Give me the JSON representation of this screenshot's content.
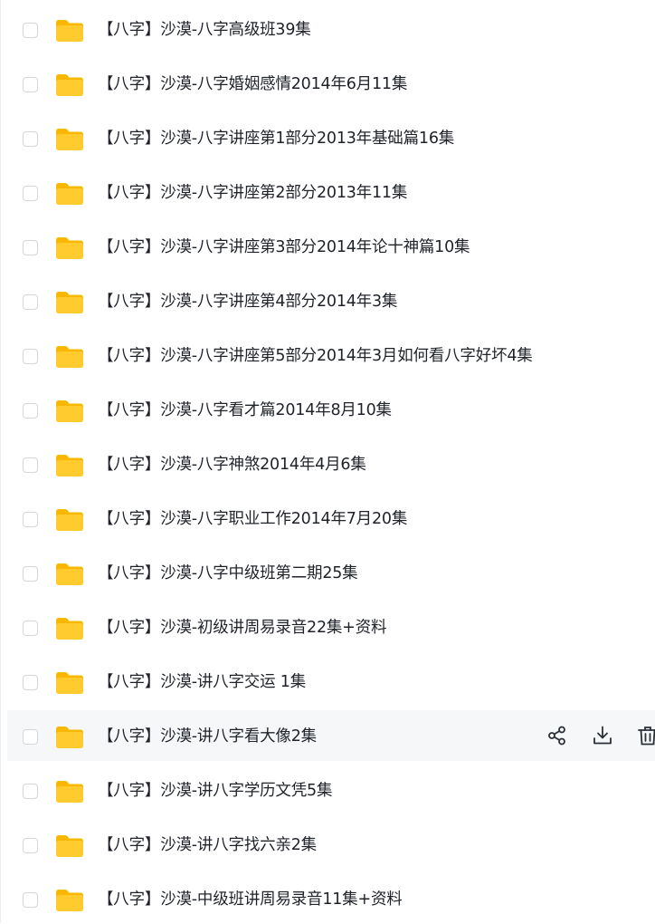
{
  "colors": {
    "folder": "#ffcb2f",
    "folder_tab": "#f9b800",
    "text": "#1f2329",
    "hover_row": "#f6f7f9",
    "checkbox_border": "#d3d6db",
    "action_icon": "#2b2f36"
  },
  "files": [
    {
      "name": "【八字】沙漠-八字高级班39集",
      "icon": "folder-icon"
    },
    {
      "name": "【八字】沙漠-八字婚姻感情2014年6月11集",
      "icon": "folder-icon"
    },
    {
      "name": "【八字】沙漠-八字讲座第1部分2013年基础篇16集",
      "icon": "folder-icon"
    },
    {
      "name": "【八字】沙漠-八字讲座第2部分2013年11集",
      "icon": "folder-icon"
    },
    {
      "name": "【八字】沙漠-八字讲座第3部分2014年论十神篇10集",
      "icon": "folder-icon"
    },
    {
      "name": "【八字】沙漠-八字讲座第4部分2014年3集",
      "icon": "folder-icon"
    },
    {
      "name": "【八字】沙漠-八字讲座第5部分2014年3月如何看八字好坏4集",
      "icon": "folder-icon"
    },
    {
      "name": "【八字】沙漠-八字看才篇2014年8月10集",
      "icon": "folder-icon"
    },
    {
      "name": "【八字】沙漠-八字神煞2014年4月6集",
      "icon": "folder-icon"
    },
    {
      "name": "【八字】沙漠-八字职业工作2014年7月20集",
      "icon": "folder-icon"
    },
    {
      "name": "【八字】沙漠-八字中级班第二期25集",
      "icon": "folder-icon"
    },
    {
      "name": "【八字】沙漠-初级讲周易录音22集+资料",
      "icon": "folder-icon"
    },
    {
      "name": "【八字】沙漠-讲八字交运 1集",
      "icon": "folder-icon"
    },
    {
      "name": "【八字】沙漠-讲八字看大像2集",
      "icon": "folder-icon",
      "hovered": true,
      "actions": [
        "share-icon",
        "download-icon",
        "trash-icon"
      ]
    },
    {
      "name": "【八字】沙漠-讲八字学历文凭5集",
      "icon": "folder-icon"
    },
    {
      "name": "【八字】沙漠-讲八字找六亲2集",
      "icon": "folder-icon"
    },
    {
      "name": "【八字】沙漠-中级班讲周易录音11集+资料",
      "icon": "folder-icon"
    }
  ]
}
